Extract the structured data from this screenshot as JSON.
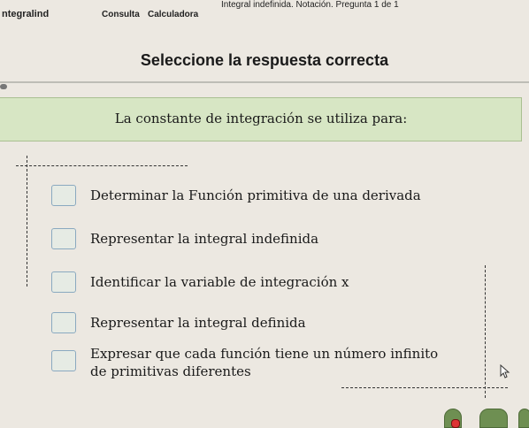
{
  "window": {
    "title": "Integral indefinida. Notación. Pregunta 1 de 1"
  },
  "menu": {
    "app_name": "ntegralind",
    "items": [
      "Consulta",
      "Calculadora"
    ]
  },
  "main": {
    "heading": "Seleccione la respuesta correcta",
    "question": "La constante de integración se utiliza para:",
    "options": [
      "Determinar la Función primitiva de una derivada",
      "Representar la integral indefinida",
      "Identificar la variable de integración x",
      "Representar la integral definida",
      "Expresar que cada función tiene un número infinito",
      "de primitivas diferentes"
    ]
  },
  "colors": {
    "question_bg": "#d7e6c4",
    "button_green": "#6e8f52",
    "checkbox_border": "#8aa9c0"
  }
}
